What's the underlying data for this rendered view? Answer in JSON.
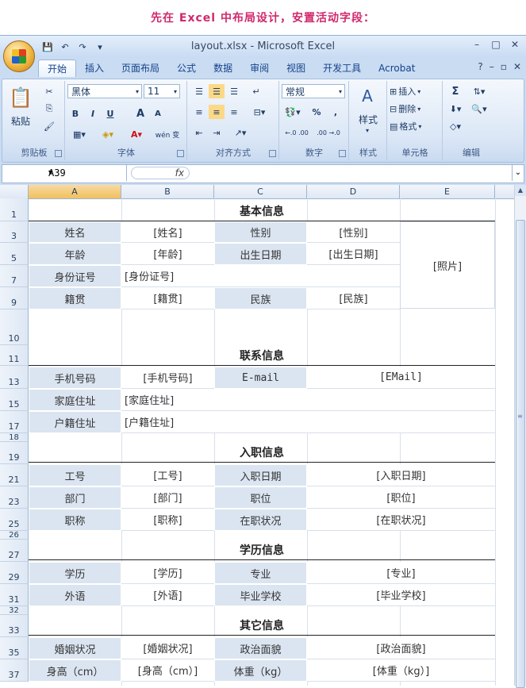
{
  "caption": "先在 Excel 中布局设计，安置活动字段：",
  "window": {
    "title": "layout.xlsx - Microsoft Excel",
    "controls": [
      "–",
      "□",
      "✕"
    ]
  },
  "tabs": [
    "开始",
    "插入",
    "页面布局",
    "公式",
    "数据",
    "审阅",
    "视图",
    "开发工具",
    "Acrobat"
  ],
  "ribbon": {
    "clipboard": {
      "label": "剪贴板",
      "paste": "粘贴"
    },
    "font": {
      "label": "字体",
      "font_name": "黑体",
      "font_size": "11",
      "bold": "B",
      "italic": "I",
      "underline": "U",
      "grow": "A",
      "shrink": "A",
      "phonetic": "wén 变"
    },
    "alignment": {
      "label": "对齐方式"
    },
    "number": {
      "label": "数字",
      "format": "常规",
      "percent": "%",
      "comma": ",",
      "inc_decimal": "←.0 .00",
      "dec_decimal": ".00 →.0"
    },
    "styles": {
      "label": "样式",
      "styles_btn": "样式"
    },
    "cells": {
      "label": "单元格",
      "insert": "插入",
      "delete": "删除",
      "format": "格式"
    },
    "editing": {
      "label": "编辑",
      "sum": "Σ"
    }
  },
  "formula_bar": {
    "name_box": "A39",
    "fx": "fx",
    "formula": ""
  },
  "columns": [
    "A",
    "B",
    "C",
    "D",
    "E"
  ],
  "sheet": {
    "sections": [
      "基本信息",
      "联系信息",
      "入职信息",
      "学历信息",
      "其它信息"
    ],
    "basic": {
      "name_label": "姓名",
      "name_value": "[姓名]",
      "gender_label": "性别",
      "gender_value": "[性别]",
      "age_label": "年龄",
      "age_value": "[年龄]",
      "dob_label": "出生日期",
      "dob_value": "[出生日期]",
      "id_label": "身份证号",
      "id_value": "[身份证号]",
      "origin_label": "籍贯",
      "origin_value": "[籍贯]",
      "ethnic_label": "民族",
      "ethnic_value": "[民族]",
      "photo": "[照片]"
    },
    "contact": {
      "mobile_label": "手机号码",
      "mobile_value": "[手机号码]",
      "email_label": "E-mail",
      "email_value": "[EMail]",
      "home_label": "家庭住址",
      "home_value": "[家庭住址]",
      "hukou_label": "户籍住址",
      "hukou_value": "[户籍住址]"
    },
    "job": {
      "empno_label": "工号",
      "empno_value": "[工号]",
      "hire_label": "入职日期",
      "hire_value": "[入职日期]",
      "dept_label": "部门",
      "dept_value": "[部门]",
      "post_label": "职位",
      "post_value": "[职位]",
      "title_label": "职称",
      "title_value": "[职称]",
      "status_label": "在职状况",
      "status_value": "[在职状况]"
    },
    "edu": {
      "degree_label": "学历",
      "degree_value": "[学历]",
      "major_label": "专业",
      "major_value": "[专业]",
      "lang_label": "外语",
      "lang_value": "[外语]",
      "school_label": "毕业学校",
      "school_value": "[毕业学校]"
    },
    "other": {
      "marital_label": "婚姻状况",
      "marital_value": "[婚姻状况]",
      "political_label": "政治面貌",
      "political_value": "[政治面貌]",
      "height_label": "身高（cm）",
      "height_value": "[身高（cm）]",
      "weight_label": "体重（kg）",
      "weight_value": "[体重（kg）]"
    }
  },
  "row_numbers": [
    "1",
    "3",
    "5",
    "7",
    "9",
    "10",
    "11",
    "13",
    "15",
    "17",
    "18",
    "19",
    "21",
    "23",
    "25",
    "26",
    "27",
    "29",
    "31",
    "32",
    "33",
    "35",
    "37"
  ]
}
